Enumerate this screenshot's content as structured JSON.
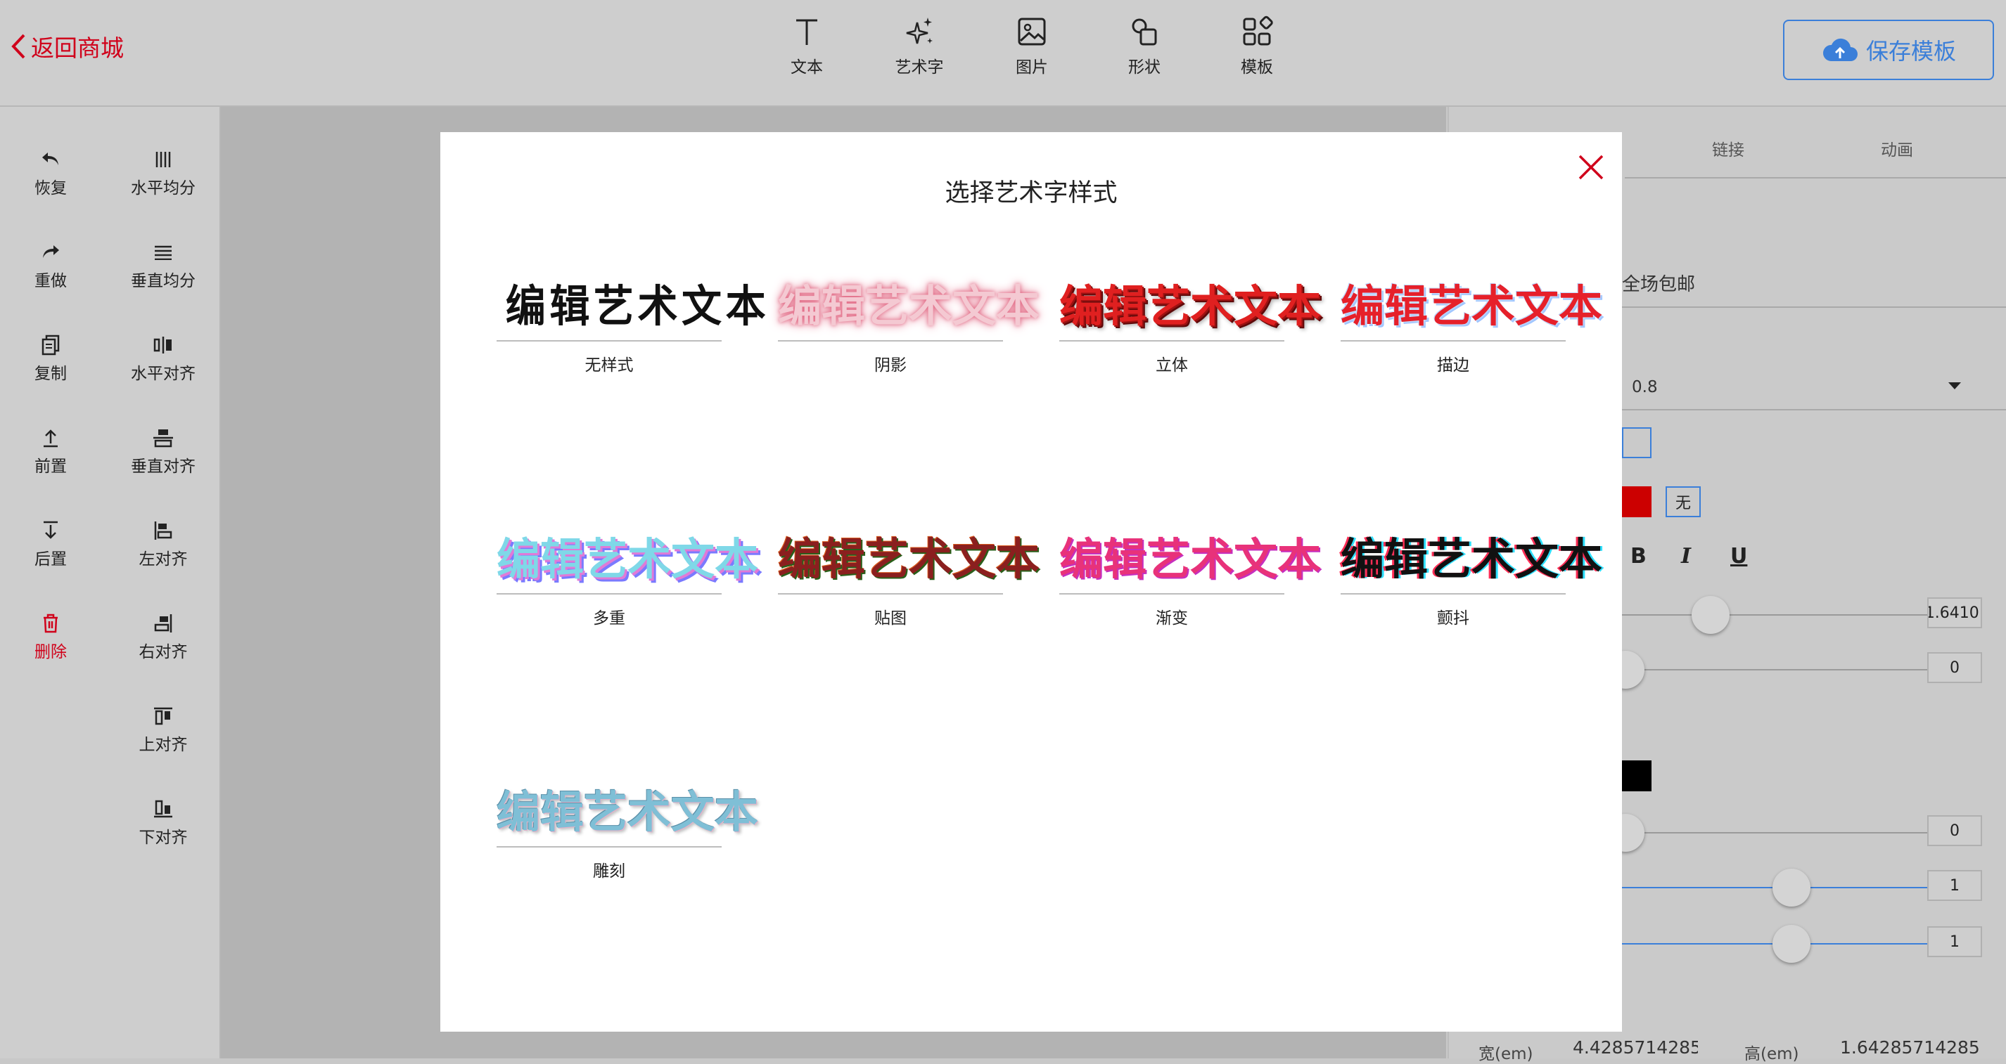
{
  "topbar": {
    "back_label": "返回商城",
    "tools": [
      {
        "label": "文本",
        "icon": "text-icon"
      },
      {
        "label": "艺术字",
        "icon": "sparkle-icon"
      },
      {
        "label": "图片",
        "icon": "image-icon"
      },
      {
        "label": "形状",
        "icon": "shape-icon"
      },
      {
        "label": "模板",
        "icon": "template-icon"
      }
    ],
    "save_label": "保存模板"
  },
  "left_toolbar": {
    "undo": "恢复",
    "redo": "重做",
    "copy": "复制",
    "front": "前置",
    "back": "后置",
    "delete": "删除",
    "h_distribute": "水平均分",
    "v_distribute": "垂直均分",
    "h_align": "水平对齐",
    "v_align": "垂直对齐",
    "left_align": "左对齐",
    "right_align": "右对齐",
    "top_align": "上对齐",
    "bottom_align": "下对齐"
  },
  "right_panel": {
    "tabs": [
      "链接",
      "动画"
    ],
    "text_value": "全场包邮",
    "select_value": "0.8",
    "none_label": "无",
    "bold": "B",
    "italic": "I",
    "underline": "U",
    "slider_values": [
      "1.6410:",
      "0",
      "0",
      "1",
      "1"
    ],
    "width_label": "宽(em)",
    "width_value": "4.42857142857",
    "height_label": "高(em)",
    "height_value": "1.64285714285",
    "colors": {
      "red_swatch": "#cc0000",
      "black_swatch": "#000000",
      "accent": "#3b7fd9"
    }
  },
  "modal": {
    "title": "选择艺术字样式",
    "sample_text": "编辑艺术文本",
    "styles": [
      "无样式",
      "阴影",
      "立体",
      "描边",
      "多重",
      "贴图",
      "渐变",
      "颤抖",
      "雕刻"
    ]
  }
}
